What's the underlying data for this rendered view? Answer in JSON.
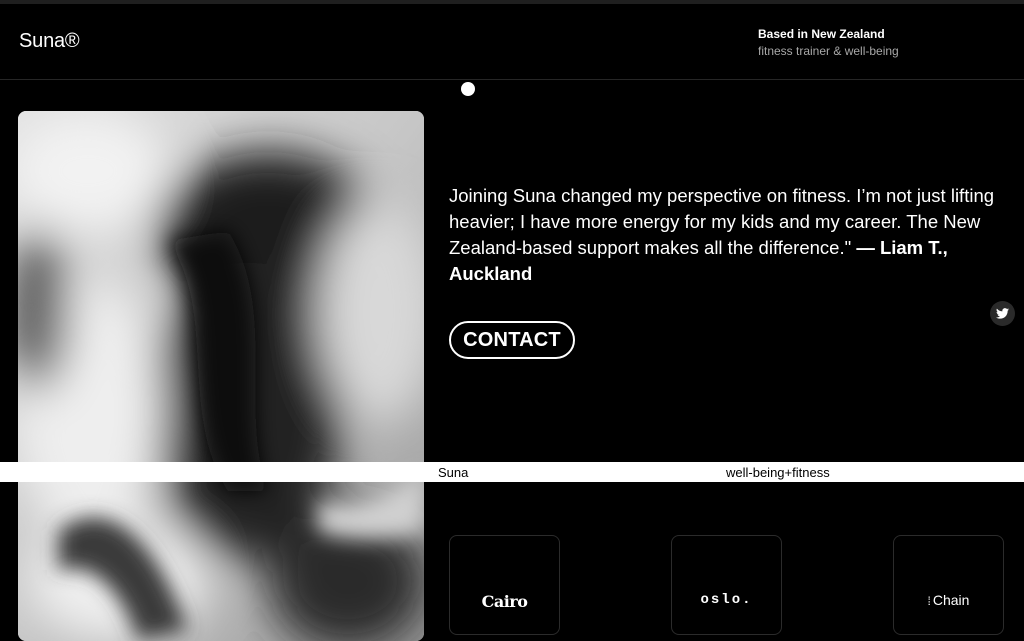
{
  "header": {
    "logo": "Suna®",
    "location_title": "Based in New Zealand",
    "location_subtitle": "fitness trainer & well-being"
  },
  "testimonial": {
    "quote": "Joining Suna changed my perspective on fitness. I’m not just lifting heavier; I have more energy for my kids and my career. The New Zealand-based support makes all the difference.\" ",
    "author": "— Liam T., Auckland"
  },
  "contact": {
    "label": "CONTACT"
  },
  "social": {
    "icon": "twitter-icon"
  },
  "band": {
    "left": "Suna",
    "right": "well-being+fitness"
  },
  "brands": [
    "Cairo",
    "oslo.",
    "Chain"
  ],
  "colors": {
    "background": "#000000",
    "text": "#ffffff",
    "muted": "#a8a8a8",
    "band": "#ffffff"
  }
}
